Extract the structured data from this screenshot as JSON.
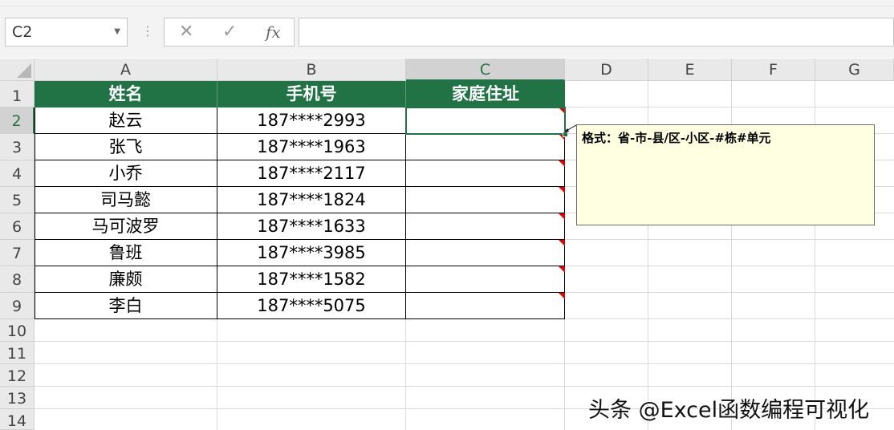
{
  "name_box": {
    "value": "C2",
    "dropdown_icon": "chevron-down-icon"
  },
  "formula_bar": {
    "cancel_icon": "✕",
    "confirm_icon": "✓",
    "fx_label": "fx",
    "value": ""
  },
  "columns": [
    "A",
    "B",
    "C",
    "D",
    "E",
    "F",
    "G"
  ],
  "rows": [
    "1",
    "2",
    "3",
    "4",
    "5",
    "6",
    "7",
    "8",
    "9",
    "10",
    "11",
    "12",
    "13",
    "14"
  ],
  "table": {
    "headers": [
      "姓名",
      "手机号",
      "家庭住址"
    ],
    "rows": [
      [
        "赵云",
        "187****2993",
        ""
      ],
      [
        "张飞",
        "187****1963",
        ""
      ],
      [
        "小乔",
        "187****2117",
        ""
      ],
      [
        "司马懿",
        "187****1824",
        ""
      ],
      [
        "马可波罗",
        "187****1633",
        ""
      ],
      [
        "鲁班",
        "187****3985",
        ""
      ],
      [
        "廉颇",
        "187****1582",
        ""
      ],
      [
        "李白",
        "187****5075",
        ""
      ]
    ]
  },
  "comment": {
    "text": "格式：省-市-县/区-小区-#栋#单元"
  },
  "watermark": {
    "text": "头条 @Excel函数编程可视化"
  },
  "colors": {
    "accent": "#217346",
    "comment_bg": "#ffffe1",
    "comment_marker": "#e00000"
  }
}
